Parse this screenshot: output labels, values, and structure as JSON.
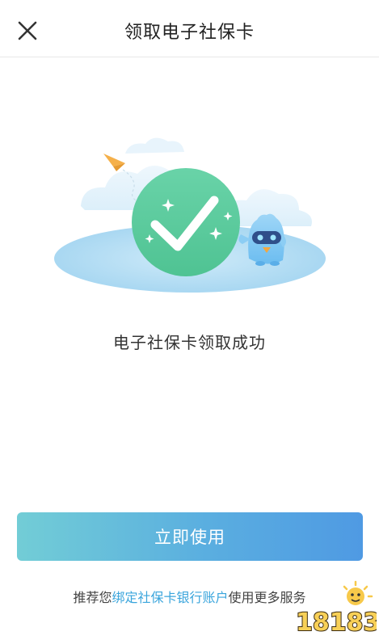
{
  "header": {
    "close_icon": "close-icon",
    "title": "领取电子社保卡"
  },
  "main": {
    "illustration_icon": "success-check-icon",
    "success_message": "电子社保卡领取成功"
  },
  "action": {
    "primary_label": "立即使用"
  },
  "footer": {
    "prefix": "推荐您",
    "link_text": "绑定社保卡银行账户",
    "suffix": "使用更多服务"
  },
  "watermark": {
    "text": "18183"
  },
  "colors": {
    "accent": "#4f9ae3",
    "success_green": "#5ecb98",
    "link_blue": "#3aa5dc"
  }
}
